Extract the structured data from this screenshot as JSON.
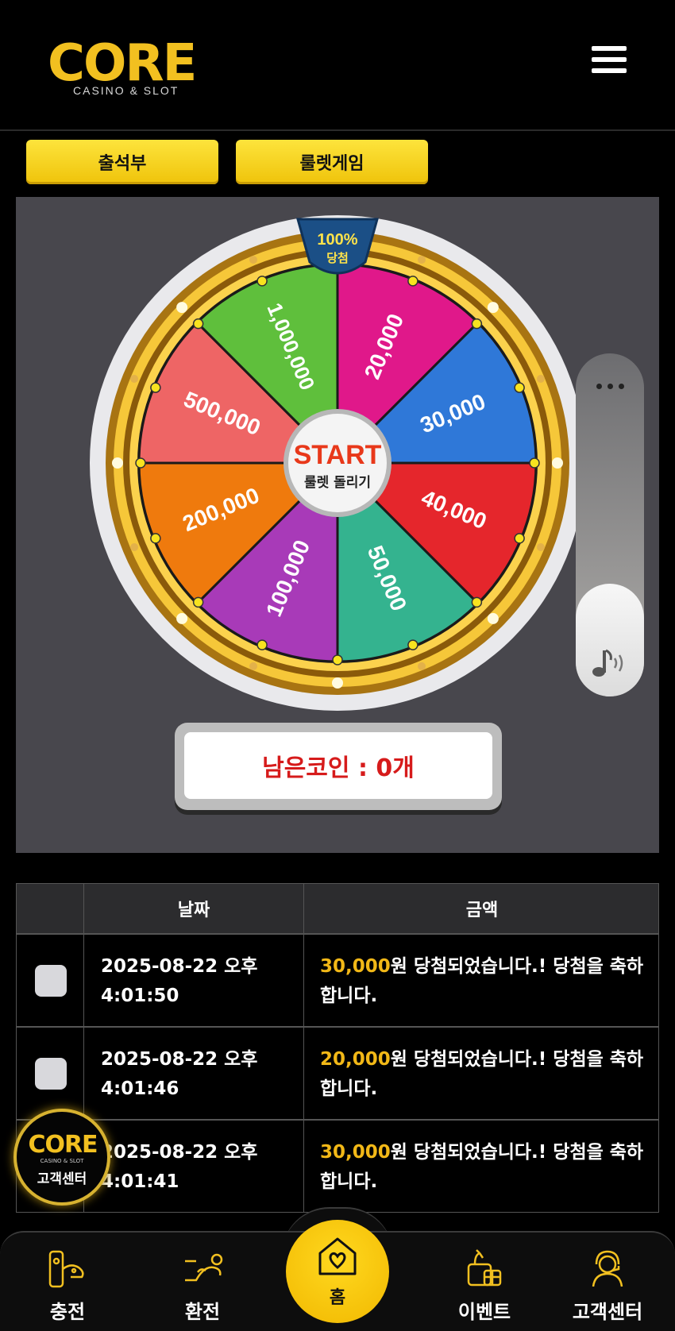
{
  "header": {
    "logo_text": "CORE",
    "logo_subtitle": "CASINO & SLOT"
  },
  "tabs": [
    {
      "label": "출석부"
    },
    {
      "label": "룰렛게임"
    }
  ],
  "roulette": {
    "badge_top": "100%",
    "badge_bottom": "당첨",
    "start_label": "START",
    "start_sub": "룰렛 돌리기",
    "segments": [
      {
        "label": "20,000",
        "color": "#e0188a"
      },
      {
        "label": "30,000",
        "color": "#2f78d8"
      },
      {
        "label": "40,000",
        "color": "#e5262c"
      },
      {
        "label": "50,000",
        "color": "#34b38f"
      },
      {
        "label": "100,000",
        "color": "#a83ab8"
      },
      {
        "label": "200,000",
        "color": "#ef7a0d"
      },
      {
        "label": "500,000",
        "color": "#ee6565"
      },
      {
        "label": "1,000,000",
        "color": "#5fbf3c"
      }
    ],
    "remaining_coins": "남은코인 : 0개"
  },
  "table": {
    "headers": [
      "",
      "날짜",
      "금액"
    ],
    "rows": [
      {
        "date": "2025-08-22 오후 4:01:50",
        "amount": "30,000",
        "message": "원 당첨되었습니다.! 당첨을 축하합니다."
      },
      {
        "date": "2025-08-22 오후 4:01:46",
        "amount": "20,000",
        "message": "원 당첨되었습니다.! 당첨을 축하합니다."
      },
      {
        "date": "2025-08-22 오후 4:01:41",
        "amount": "30,000",
        "message": "원 당첨되었습니다.! 당첨을 축하합니다."
      }
    ]
  },
  "cs_badge": {
    "logo_text": "CORE",
    "subtitle": "CASINO & SLOT",
    "label": "고객센터"
  },
  "bottom_nav": [
    {
      "label": "충전",
      "icon": "deposit-icon"
    },
    {
      "label": "환전",
      "icon": "withdraw-icon"
    },
    {
      "label": "홈",
      "icon": "home-heart-icon"
    },
    {
      "label": "이벤트",
      "icon": "gift-icon"
    },
    {
      "label": "고객센터",
      "icon": "support-agent-icon"
    }
  ],
  "colors": {
    "accent_yellow": "#f2c020",
    "amount_yellow": "#f2b817",
    "coin_red": "#d61b1b",
    "panel_gray": "#48474d"
  }
}
